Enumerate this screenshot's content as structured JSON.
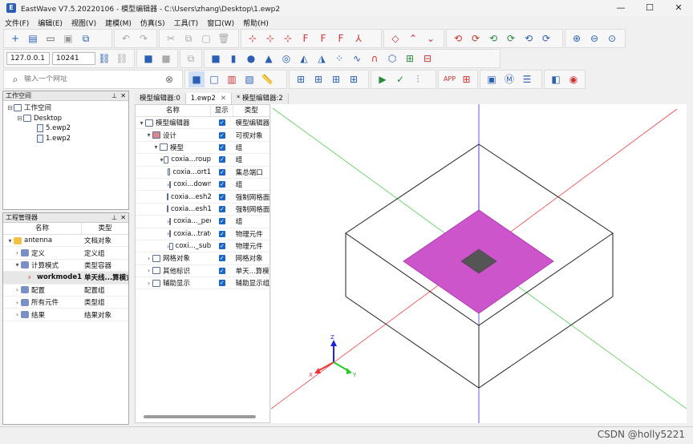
{
  "window": {
    "title": "EastWave V7.5.20220106 - 模型编辑器 - C:\\Users\\zhang\\Desktop\\1.ewp2",
    "minimize": "—",
    "maximize": "☐",
    "close": "✕"
  },
  "menu": [
    "文件(F)",
    "编辑(E)",
    "视图(V)",
    "建模(M)",
    "仿真(S)",
    "工具(T)",
    "窗口(W)",
    "帮助(H)"
  ],
  "connection": {
    "host": "127.0.0.1",
    "port": "10241"
  },
  "search": {
    "placeholder": "输入一个网址"
  },
  "workspace": {
    "title": "工作空间",
    "tree": [
      {
        "label": "工作空间",
        "level": 0,
        "icon": "folder"
      },
      {
        "label": "Desktop",
        "level": 1,
        "icon": "folder"
      },
      {
        "label": "5.ewp2",
        "level": 2,
        "icon": "file"
      },
      {
        "label": "1.ewp2",
        "level": 2,
        "icon": "file"
      }
    ]
  },
  "project_manager": {
    "title": "工程管理器",
    "col_name": "名称",
    "col_type": "类型",
    "rows": [
      {
        "name": "antenna",
        "type": "文档对象",
        "level": 0,
        "arrow": "▾",
        "icon": "folder-icon",
        "bold": false
      },
      {
        "name": "定义",
        "type": "定义组",
        "level": 1,
        "arrow": "›",
        "icon": "edit-icon",
        "bold": false
      },
      {
        "name": "计算模式",
        "type": "类型容器",
        "level": 1,
        "arrow": "▾",
        "icon": "m-circle-icon",
        "bold": false
      },
      {
        "name": "workmode1",
        "type": "单天线...算模式",
        "level": 2,
        "arrow": "",
        "icon": "antenna-icon",
        "bold": true
      },
      {
        "name": "配置",
        "type": "配置组",
        "level": 1,
        "arrow": "›",
        "icon": "config-icon",
        "bold": false
      },
      {
        "name": "所有元件",
        "type": "类型组",
        "level": 1,
        "arrow": "›",
        "icon": "components-icon",
        "bold": false
      },
      {
        "name": "结果",
        "type": "结果对象",
        "level": 1,
        "arrow": "›",
        "icon": "result-icon",
        "bold": false
      }
    ]
  },
  "tabs": [
    {
      "label": "模型编辑器:0",
      "close": ""
    },
    {
      "label": "1.ewp2",
      "close": "✕"
    },
    {
      "label": "* 模型编辑器:2",
      "close": ""
    }
  ],
  "model_tree": {
    "col_name": "名称",
    "col_show": "显示",
    "col_type": "类型",
    "rows": [
      {
        "name": "模型编辑器",
        "type": "模型编辑器",
        "level": 0,
        "arrow": "▾",
        "icon": "editor-icon"
      },
      {
        "name": "设计",
        "type": "可视对象",
        "level": 1,
        "arrow": "▾",
        "icon": "design-icon"
      },
      {
        "name": "模型",
        "type": "组",
        "level": 2,
        "arrow": "▾",
        "icon": "model-icon"
      },
      {
        "name": "coxia...roup",
        "type": "组",
        "level": 3,
        "arrow": "▾",
        "icon": "folder-icon"
      },
      {
        "name": "coxia...ort1",
        "type": "集总端口",
        "level": 4,
        "arrow": "",
        "icon": "port-icon"
      },
      {
        "name": "coxi...down",
        "type": "组",
        "level": 4,
        "arrow": "›",
        "icon": "folder-icon"
      },
      {
        "name": "coxia...esh2",
        "type": "强制网格面",
        "level": 4,
        "arrow": "",
        "icon": "mesh-icon"
      },
      {
        "name": "coxia...esh1",
        "type": "强制网格面",
        "level": 4,
        "arrow": "",
        "icon": "mesh-icon"
      },
      {
        "name": "coxia..._pec",
        "type": "组",
        "level": 4,
        "arrow": "›",
        "icon": "folder-icon"
      },
      {
        "name": "coxia...trate",
        "type": "物理元件",
        "level": 4,
        "arrow": "›",
        "icon": "folder-icon"
      },
      {
        "name": "coxi..._sub",
        "type": "物理元件",
        "level": 4,
        "arrow": "›",
        "icon": "folder-icon"
      },
      {
        "name": "网格对象",
        "type": "网格对象",
        "level": 1,
        "arrow": "›",
        "icon": "grid-icon"
      },
      {
        "name": "其他标识",
        "type": "单天...算模式",
        "level": 1,
        "arrow": "›",
        "icon": "tag-icon"
      },
      {
        "name": "辅助显示",
        "type": "辅助显示组",
        "level": 1,
        "arrow": "›",
        "icon": "eye-icon"
      }
    ]
  },
  "axes": {
    "x": "X",
    "y": "Y",
    "z": "Z"
  },
  "watermark": "CSDN @holly5221",
  "colors": {
    "patch": "#cc55cc",
    "accent": "#1a66c9",
    "axis_red": "#ee3333",
    "axis_green": "#22cc22",
    "axis_blue": "#2222dd"
  }
}
